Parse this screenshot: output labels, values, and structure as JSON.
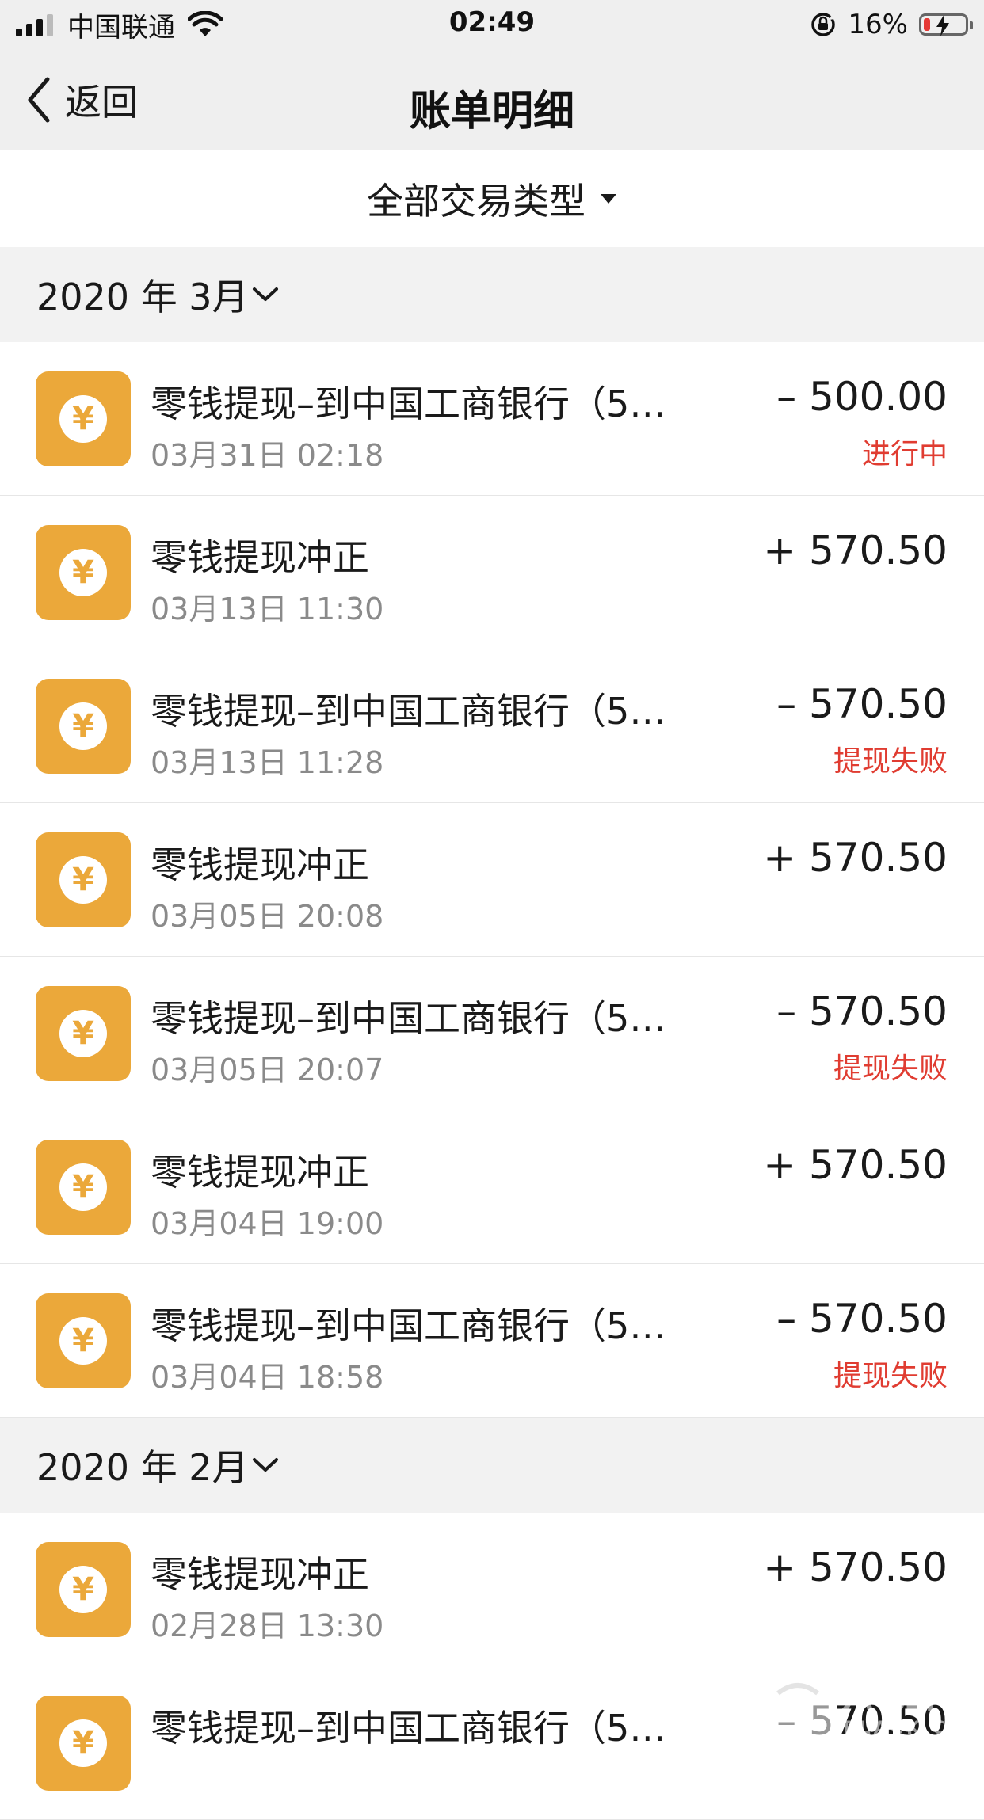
{
  "status_bar": {
    "carrier": "中国联通",
    "time": "02:49",
    "battery_percent": "16%",
    "battery_level": 0.16,
    "battery_color": "#e53935"
  },
  "nav": {
    "back_label": "返回",
    "title": "账单明细"
  },
  "filter": {
    "label": "全部交易类型"
  },
  "icons": {
    "transaction_icon": "yuan-coin-icon",
    "transaction_glyph": "¥",
    "accent_color": "#eba83a",
    "failure_color": "#e03c31"
  },
  "sections": [
    {
      "month": "2020 年 3月",
      "items": [
        {
          "title": "零钱提现–到中国工商银行（5…",
          "date": "03月31日 02:18",
          "amount": "– 500.00",
          "status": "进行中"
        },
        {
          "title": "零钱提现冲正",
          "date": "03月13日 11:30",
          "amount": "+ 570.50",
          "status": ""
        },
        {
          "title": "零钱提现–到中国工商银行（5…",
          "date": "03月13日 11:28",
          "amount": "– 570.50",
          "status": "提现失败"
        },
        {
          "title": "零钱提现冲正",
          "date": "03月05日 20:08",
          "amount": "+ 570.50",
          "status": ""
        },
        {
          "title": "零钱提现–到中国工商银行（5…",
          "date": "03月05日 20:07",
          "amount": "– 570.50",
          "status": "提现失败"
        },
        {
          "title": "零钱提现冲正",
          "date": "03月04日 19:00",
          "amount": "+ 570.50",
          "status": ""
        },
        {
          "title": "零钱提现–到中国工商银行（5…",
          "date": "03月04日 18:58",
          "amount": "– 570.50",
          "status": "提现失败"
        }
      ]
    },
    {
      "month": "2020 年 2月",
      "items": [
        {
          "title": "零钱提现冲正",
          "date": "02月28日 13:30",
          "amount": "+ 570.50",
          "status": ""
        },
        {
          "title": "零钱提现–到中国工商银行（5…",
          "date": "",
          "amount": "– 570.50",
          "status": ""
        }
      ]
    }
  ],
  "watermark": {
    "text": "黑猫",
    "sub": "BLACK CAT"
  }
}
